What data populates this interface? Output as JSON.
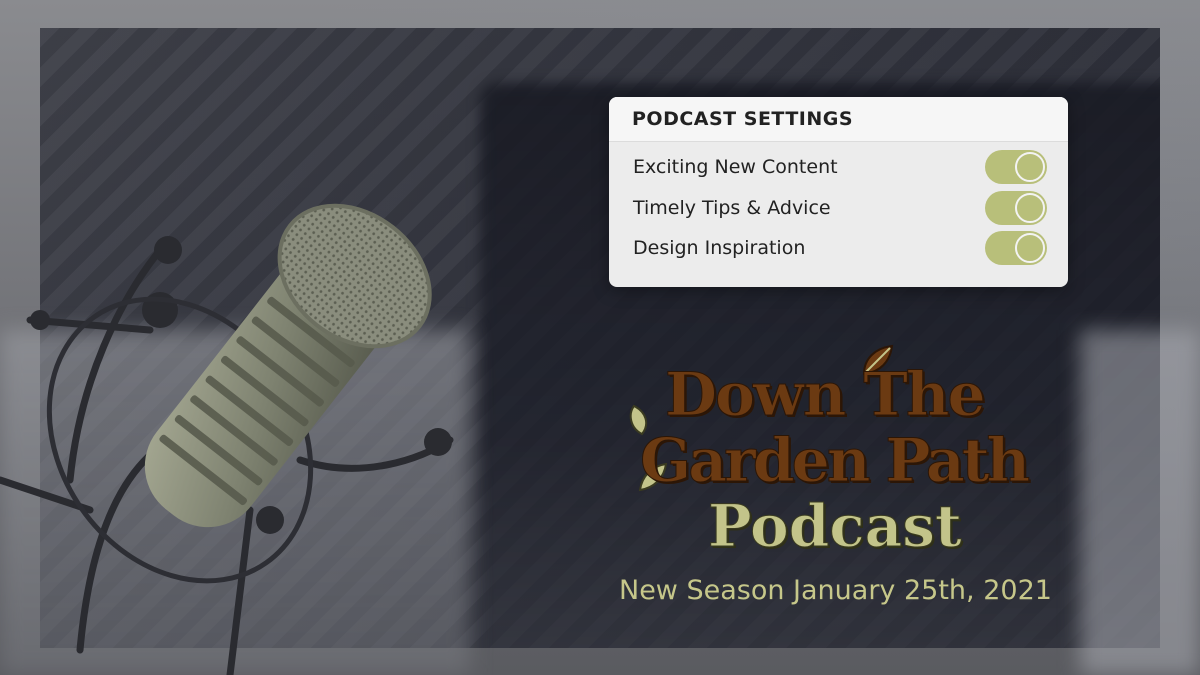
{
  "settings": {
    "header": "PODCAST SETTINGS",
    "items": [
      {
        "label": "Exciting New Content",
        "enabled": true
      },
      {
        "label": "Timely Tips & Advice",
        "enabled": true
      },
      {
        "label": "Design Inspiration",
        "enabled": true
      }
    ],
    "toggle_color": "#b8bf7a"
  },
  "logo": {
    "line1": "Down The",
    "line2": "Garden Path",
    "line3": "Podcast",
    "primary_color": "#6b3a12",
    "accent_color": "#c3c48a"
  },
  "announcement": "New Season January 25th, 2021",
  "icons": {
    "microphone": "microphone-icon",
    "leaf": "leaf-icon"
  }
}
